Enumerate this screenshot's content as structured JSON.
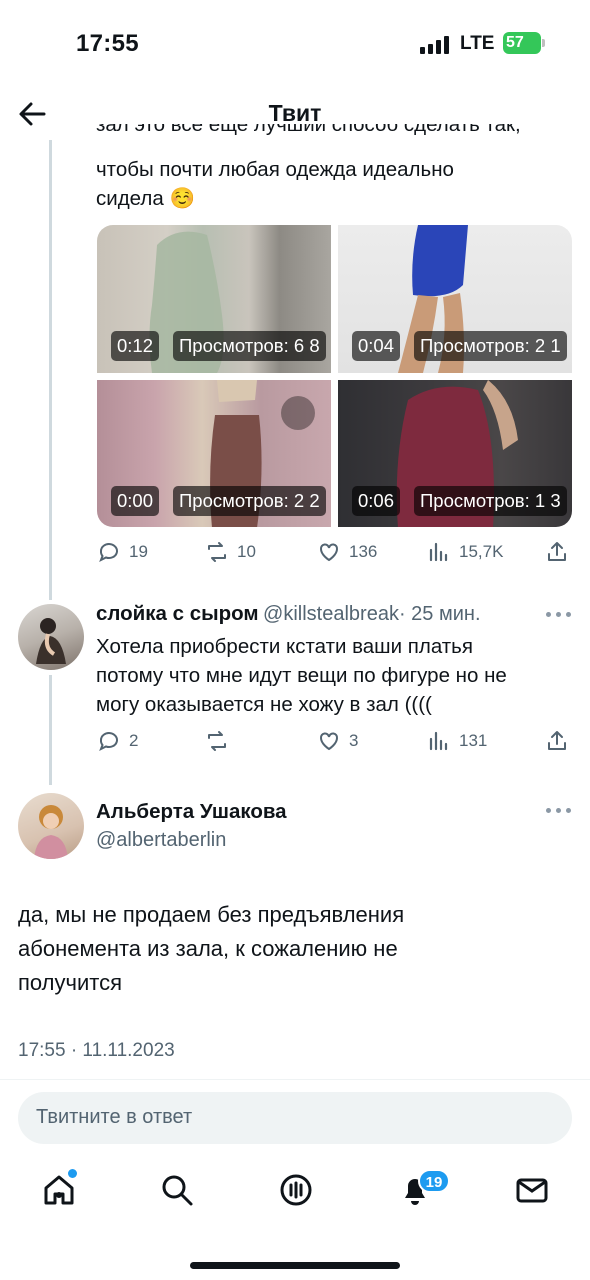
{
  "status_bar": {
    "time": "17:55",
    "network": "LTE",
    "battery": "57"
  },
  "header": {
    "title": "Твит"
  },
  "tweet_prev": {
    "text_cut": "зал это все еще лучший способ сделать так,",
    "text_line2": "чтобы почти любая одежда идеально",
    "text_line3": "сидела ☺️",
    "media": [
      {
        "duration": "0:12",
        "views": "Просмотров: 6 8"
      },
      {
        "duration": "0:04",
        "views": "Просмотров: 2 1"
      },
      {
        "duration": "0:00",
        "views": "Просмотров: 2 2"
      },
      {
        "duration": "0:06",
        "views": "Просмотров: 1 3"
      }
    ],
    "replies": "19",
    "retweets": "10",
    "likes": "136",
    "views": "15,7K"
  },
  "tweet_reply": {
    "name": "слойка с сыром",
    "handle": "@killstealbreak",
    "time": "· 25 мин.",
    "text_line1": "Хотела приобрести кстати ваши платья",
    "text_line2": "потому что мне идут вещи по фигуре но не",
    "text_line3": "могу оказывается не хожу в зал ((((",
    "replies": "2",
    "retweets": "",
    "likes": "3",
    "views": "131"
  },
  "main_tweet": {
    "name": "Альберта Ушакова",
    "handle": "@albertaberlin",
    "text_line1": "да, мы не продаем без предъявления",
    "text_line2": "абонемента из зала, к сожалению не",
    "text_line3": "получится",
    "timestamp": "17:55 · 11.11.2023"
  },
  "reply_input": {
    "placeholder": "Твитните в ответ"
  },
  "tabbar": {
    "notifications_count": "19"
  },
  "colors": {
    "accent": "#1d9bf0",
    "secondary_text": "#536471",
    "battery": "#34c759"
  }
}
